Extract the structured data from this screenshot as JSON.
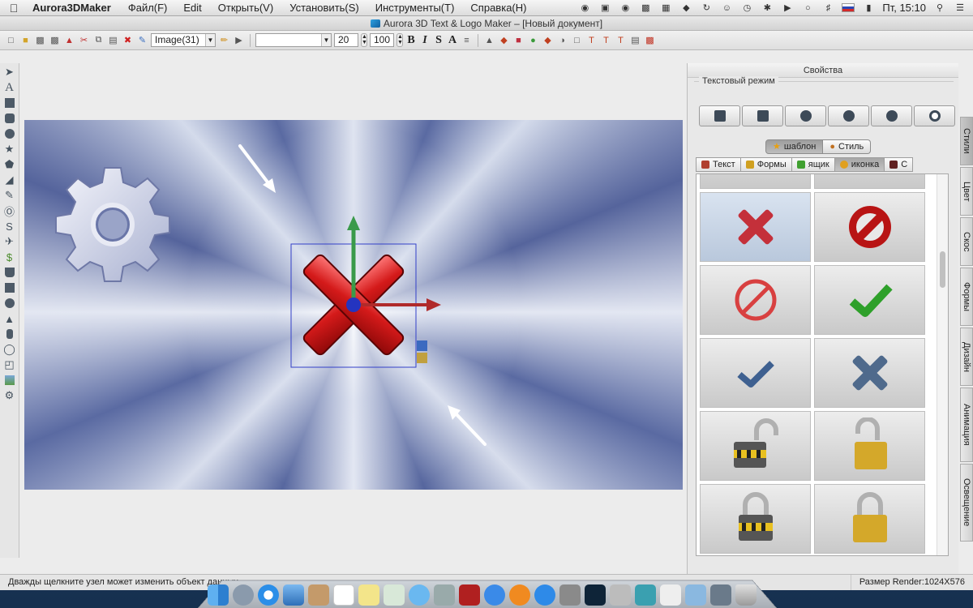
{
  "menubar": {
    "app_name": "Aurora3DMaker",
    "items": [
      "Файл(F)",
      "Edit",
      "Открыть(V)",
      "Установить(S)",
      "Инструменты(T)",
      "Справка(H)"
    ],
    "clock": "Пт, 15:10"
  },
  "window": {
    "title": "Aurora 3D Text & Logo Maker – [Новый документ]"
  },
  "toolbar": {
    "image_select": "Image(31)",
    "font_select": "",
    "size_value": "20",
    "depth_value": "100",
    "bold": "B",
    "italic": "I",
    "strike": "S",
    "font_color": "A"
  },
  "panel": {
    "title": "Свойства",
    "text_mode_label": "Текстовый режим",
    "segments": [
      "шаблон",
      "Стиль"
    ],
    "tabs": [
      "Текст",
      "Формы",
      "ящик",
      "иконка",
      "С"
    ],
    "gallery_items": [
      "cross-red",
      "forbidden-solid",
      "forbidden-outline",
      "check-green",
      "check-blue",
      "cross-blue",
      "padlock-open-striped",
      "padlock-open-gold",
      "padlock-closed-striped",
      "padlock-closed-gold"
    ]
  },
  "side_tabs": [
    "Стили",
    "Цвет",
    "Скос",
    "Формы",
    "Дизайн",
    "Анимация",
    "Освещение"
  ],
  "status": {
    "left": "Дважды щелкните узел может изменить объект данных",
    "right": "Размер Render:1024X576"
  },
  "colors": {
    "selection_box": "#3340c8",
    "x_icon_red": "#d11818",
    "canvas_blue": "#5a6aa2"
  }
}
